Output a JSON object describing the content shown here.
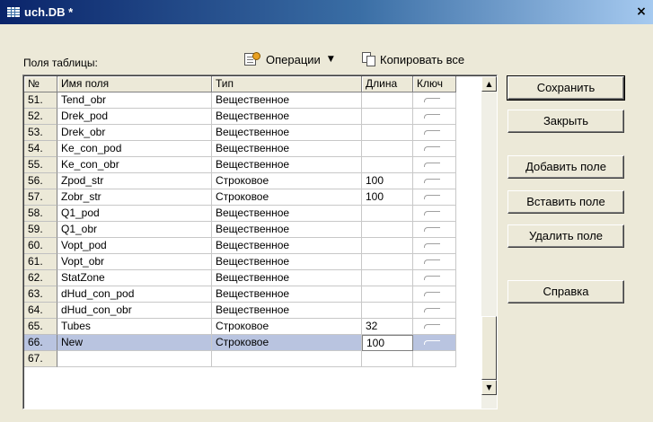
{
  "window": {
    "title": "uch.DB *",
    "close_glyph": "×"
  },
  "fields_label": "Поля таблицы:",
  "toolbar": {
    "operations_label": "Операции",
    "operations_icon": "operations-icon",
    "dropdown_glyph": "▼",
    "copy_all_label": "Копировать все",
    "copy_icon": "copy-icon"
  },
  "grid": {
    "headers": {
      "no": "№",
      "name": "Имя поля",
      "type": "Тип",
      "length": "Длина",
      "key": "Ключ"
    },
    "rows": [
      {
        "no": "51.",
        "name": "Tend_obr",
        "type": "Вещественное",
        "length": ""
      },
      {
        "no": "52.",
        "name": "Drek_pod",
        "type": "Вещественное",
        "length": ""
      },
      {
        "no": "53.",
        "name": "Drek_obr",
        "type": "Вещественное",
        "length": ""
      },
      {
        "no": "54.",
        "name": "Ke_con_pod",
        "type": "Вещественное",
        "length": ""
      },
      {
        "no": "55.",
        "name": "Ke_con_obr",
        "type": "Вещественное",
        "length": ""
      },
      {
        "no": "56.",
        "name": "Zpod_str",
        "type": "Строковое",
        "length": "100"
      },
      {
        "no": "57.",
        "name": "Zobr_str",
        "type": "Строковое",
        "length": "100"
      },
      {
        "no": "58.",
        "name": "Q1_pod",
        "type": "Вещественное",
        "length": ""
      },
      {
        "no": "59.",
        "name": "Q1_obr",
        "type": "Вещественное",
        "length": ""
      },
      {
        "no": "60.",
        "name": "Vopt_pod",
        "type": "Вещественное",
        "length": ""
      },
      {
        "no": "61.",
        "name": "Vopt_obr",
        "type": "Вещественное",
        "length": ""
      },
      {
        "no": "62.",
        "name": "StatZone",
        "type": "Вещественное",
        "length": ""
      },
      {
        "no": "63.",
        "name": "dHud_con_pod",
        "type": "Вещественное",
        "length": ""
      },
      {
        "no": "64.",
        "name": "dHud_con_obr",
        "type": "Вещественное",
        "length": ""
      },
      {
        "no": "65.",
        "name": "Tubes",
        "type": "Строковое",
        "length": "32"
      },
      {
        "no": "66.",
        "name": "New",
        "type": "Строковое",
        "length": "100",
        "selected": true
      },
      {
        "no": "67.",
        "name": "",
        "type": "",
        "length": ""
      }
    ],
    "scroll_up_glyph": "▲",
    "scroll_down_glyph": "▼"
  },
  "buttons": {
    "save": "Сохранить",
    "close": "Закрыть",
    "add_field": "Добавить поле",
    "insert_field": "Вставить поле",
    "delete_field": "Удалить поле",
    "help": "Справка"
  },
  "colors": {
    "titlebar_start": "#0a246a",
    "titlebar_end": "#a6caf0",
    "selection": "#b9c4e0",
    "face": "#ece9d8"
  }
}
